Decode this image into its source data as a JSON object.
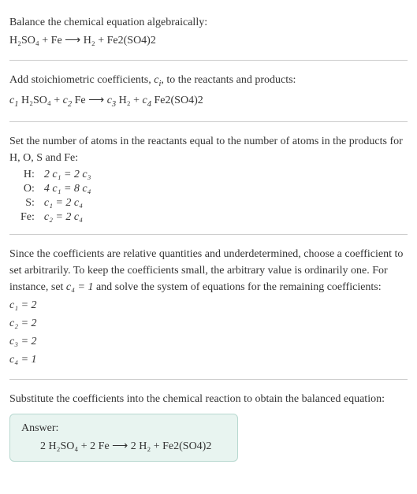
{
  "s1": {
    "title": "Balance the chemical equation algebraically:",
    "eq": "H₂SO₄ + Fe ⟶ H₂ + Fe2(SO4)2"
  },
  "s2": {
    "title_a": "Add stoichiometric coefficients, ",
    "title_ci": "c",
    "title_ci_sub": "i",
    "title_b": ", to the reactants and products:",
    "eq_c1": "c",
    "eq": " H₂SO₄ + ",
    "eq2": " Fe ⟶ ",
    "eq3": " H₂ + ",
    "eq4": " Fe2(SO4)2"
  },
  "s3": {
    "title": "Set the number of atoms in the reactants equal to the number of atoms in the products for H, O, S and Fe:",
    "rows": [
      {
        "el": "H:",
        "eq": "2 c₁ = 2 c₃"
      },
      {
        "el": "O:",
        "eq": "4 c₁ = 8 c₄"
      },
      {
        "el": "S:",
        "eq": "c₁ = 2 c₄"
      },
      {
        "el": "Fe:",
        "eq": "c₂ = 2 c₄"
      }
    ]
  },
  "s4": {
    "title_a": "Since the coefficients are relative quantities and underdetermined, choose a coefficient to set arbitrarily. To keep the coefficients small, the arbitrary value is ordinarily one. For instance, set ",
    "title_c4": "c₄ = 1",
    "title_b": " and solve the system of equations for the remaining coefficients:",
    "lines": [
      "c₁ = 2",
      "c₂ = 2",
      "c₃ = 2",
      "c₄ = 1"
    ]
  },
  "s5": {
    "title": "Substitute the coefficients into the chemical reaction to obtain the balanced equation:",
    "answer_label": "Answer:",
    "answer_eq": "2 H₂SO₄ + 2 Fe ⟶ 2 H₂ + Fe2(SO4)2"
  },
  "chart_data": {
    "type": "table",
    "title": "Balancing chemical equation H2SO4 + Fe → H2 + Fe2(SO4)2",
    "atom_balance": [
      {
        "element": "H",
        "equation": "2 c1 = 2 c3"
      },
      {
        "element": "O",
        "equation": "4 c1 = 8 c4"
      },
      {
        "element": "S",
        "equation": "c1 = 2 c4"
      },
      {
        "element": "Fe",
        "equation": "c2 = 2 c4"
      }
    ],
    "solution": {
      "c1": 2,
      "c2": 2,
      "c3": 2,
      "c4": 1
    },
    "balanced_equation": "2 H2SO4 + 2 Fe → 2 H2 + Fe2(SO4)2"
  }
}
